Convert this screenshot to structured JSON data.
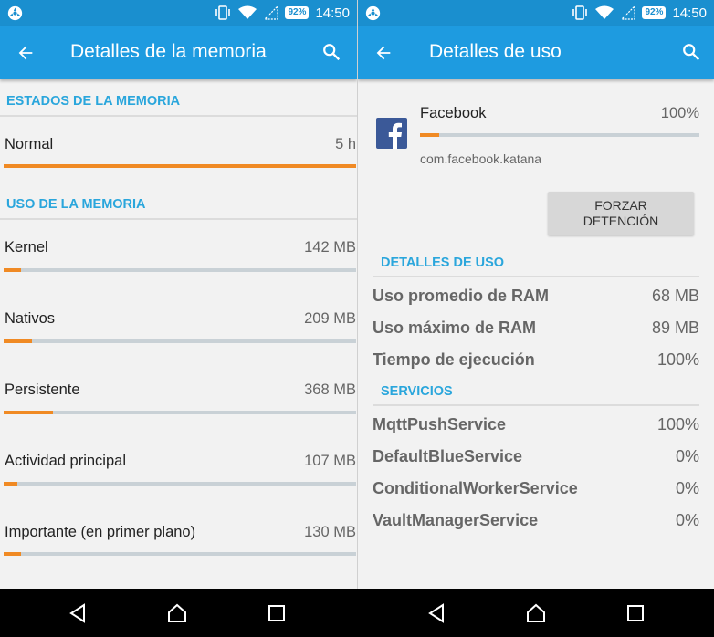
{
  "status_bar": {
    "time": "14:50",
    "battery": "92%"
  },
  "left_screen": {
    "title": "Detalles de la memoria",
    "section_states": "ESTADOS DE LA MEMORIA",
    "state_row": {
      "label": "Normal",
      "value": "5 h",
      "progress": 1.0
    },
    "section_usage": "USO DE LA MEMORIA",
    "usage_rows": [
      {
        "label": "Kernel",
        "value": "142 MB",
        "progress": 0.05
      },
      {
        "label": "Nativos",
        "value": "209 MB",
        "progress": 0.08
      },
      {
        "label": "Persistente",
        "value": "368 MB",
        "progress": 0.14
      },
      {
        "label": "Actividad principal",
        "value": "107 MB",
        "progress": 0.04
      },
      {
        "label": "Importante (en primer plano)",
        "value": "130 MB",
        "progress": 0.05
      }
    ]
  },
  "right_screen": {
    "title": "Detalles de uso",
    "app": {
      "name": "Facebook",
      "percent": "100%",
      "package": "com.facebook.katana",
      "progress": 0.07
    },
    "force_stop_line1": "FORZAR",
    "force_stop_line2": "DETENCIÓN",
    "section_usage": "DETALLES DE USO",
    "usage_details": [
      {
        "label": "Uso promedio de RAM",
        "value": "68 MB"
      },
      {
        "label": "Uso máximo de RAM",
        "value": "89 MB"
      },
      {
        "label": "Tiempo de ejecución",
        "value": "100%"
      }
    ],
    "section_services": "SERVICIOS",
    "services": [
      {
        "label": "MqttPushService",
        "value": "100%"
      },
      {
        "label": "DefaultBlueService",
        "value": "0%"
      },
      {
        "label": "ConditionalWorkerService",
        "value": "0%"
      },
      {
        "label": "VaultManagerService",
        "value": "0%"
      }
    ]
  },
  "icons": {
    "status": [
      "screen-record-icon",
      "vibrate-icon",
      "wifi-icon",
      "signal-icon",
      "battery-icon"
    ],
    "appbar": [
      "back-arrow-icon",
      "search-icon"
    ],
    "navigation": [
      "nav-back-icon",
      "nav-home-icon",
      "nav-recents-icon"
    ]
  },
  "colors": {
    "statusbar": "#1a8fcf",
    "appbar": "#1e9be0",
    "accent": "#2aa6dc",
    "progress": "#f08a24",
    "track": "#c9d1d6",
    "facebook": "#3b5998"
  }
}
